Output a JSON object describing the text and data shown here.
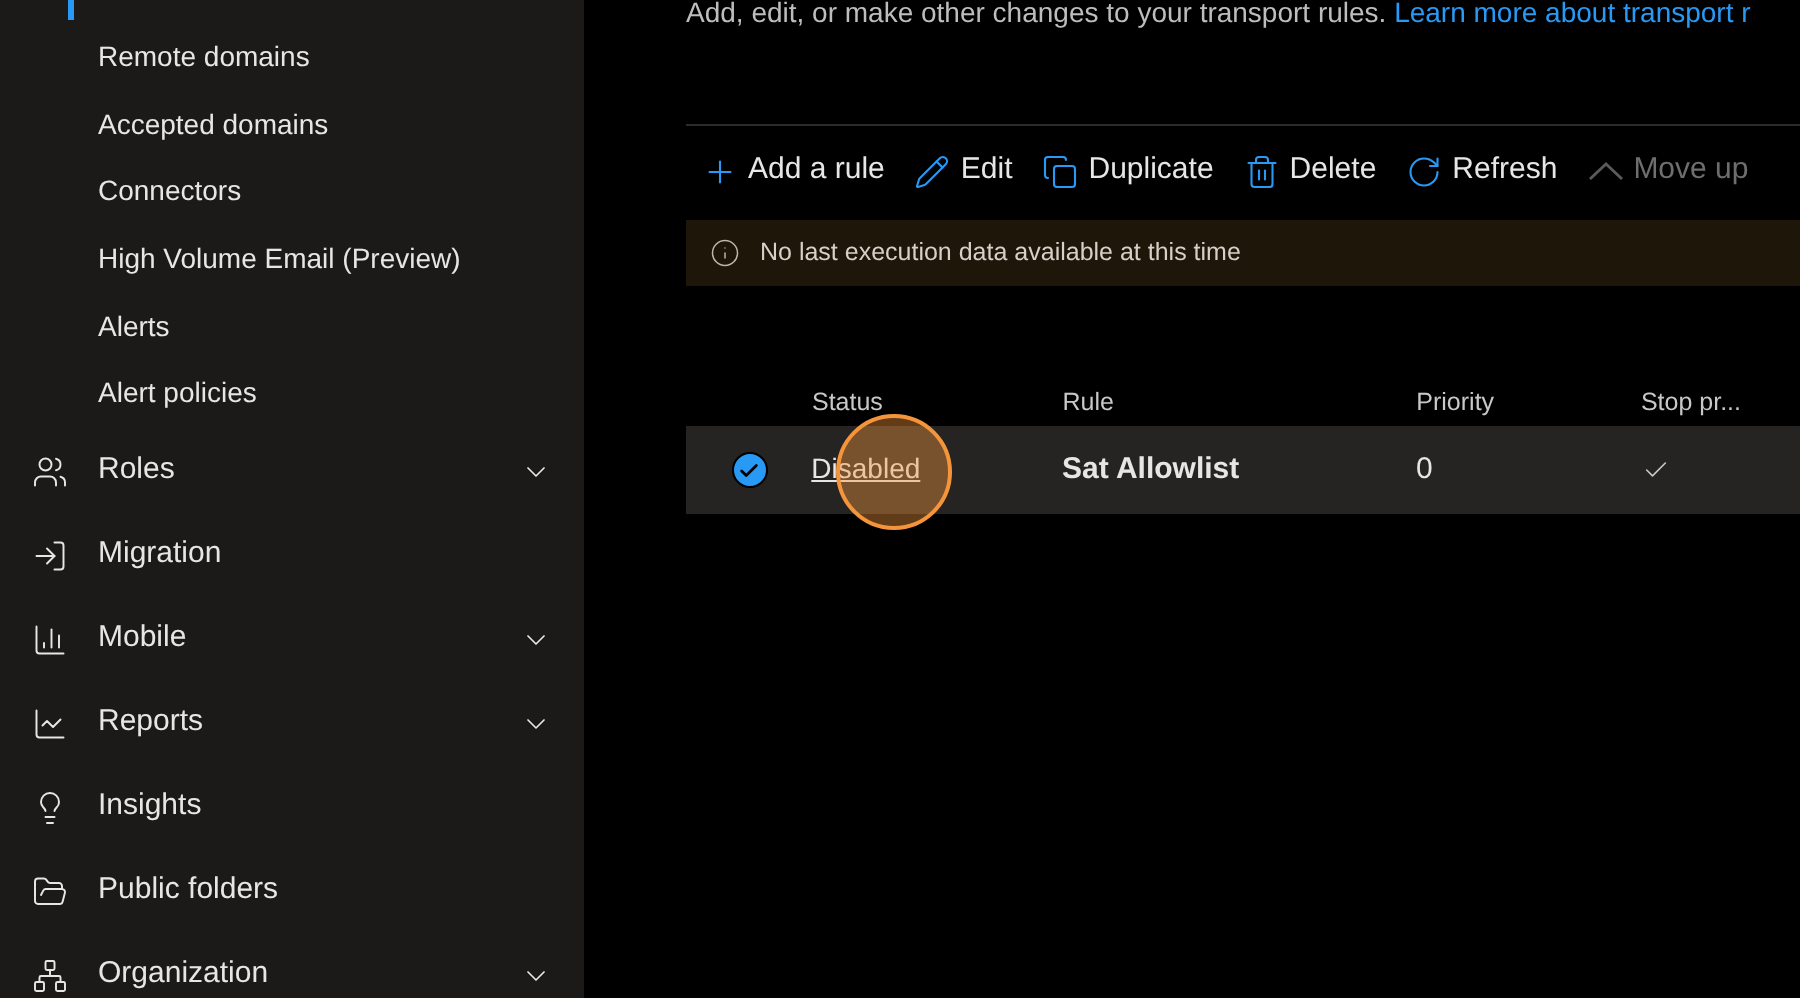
{
  "sidebar": {
    "sub_items": [
      {
        "label": "Remote domains"
      },
      {
        "label": "Accepted domains"
      },
      {
        "label": "Connectors"
      },
      {
        "label": "High Volume Email (Preview)"
      },
      {
        "label": "Alerts"
      },
      {
        "label": "Alert policies"
      }
    ],
    "items": [
      {
        "label": "Roles",
        "expanded": false
      },
      {
        "label": "Migration"
      },
      {
        "label": "Mobile",
        "expanded": false
      },
      {
        "label": "Reports",
        "expanded": false
      },
      {
        "label": "Insights"
      },
      {
        "label": "Public folders"
      },
      {
        "label": "Organization",
        "expanded": false
      }
    ]
  },
  "description": {
    "text": "Add, edit, or make other changes to your transport rules.",
    "link": "Learn more about transport r"
  },
  "toolbar": [
    {
      "label": "Add a rule",
      "disabled": false
    },
    {
      "label": "Edit",
      "disabled": false
    },
    {
      "label": "Duplicate",
      "disabled": false
    },
    {
      "label": "Delete",
      "disabled": false
    },
    {
      "label": "Refresh",
      "disabled": false
    },
    {
      "label": "Move up",
      "disabled": true
    }
  ],
  "info_bar": {
    "text": "No last execution data available at this time"
  },
  "table": {
    "columns": [
      "Status",
      "Rule",
      "Priority",
      "Stop pr..."
    ],
    "rows": [
      {
        "selected": true,
        "status": "Disabled",
        "rule": "Sat Allowlist",
        "priority": "0",
        "stop_processing": true
      }
    ]
  }
}
